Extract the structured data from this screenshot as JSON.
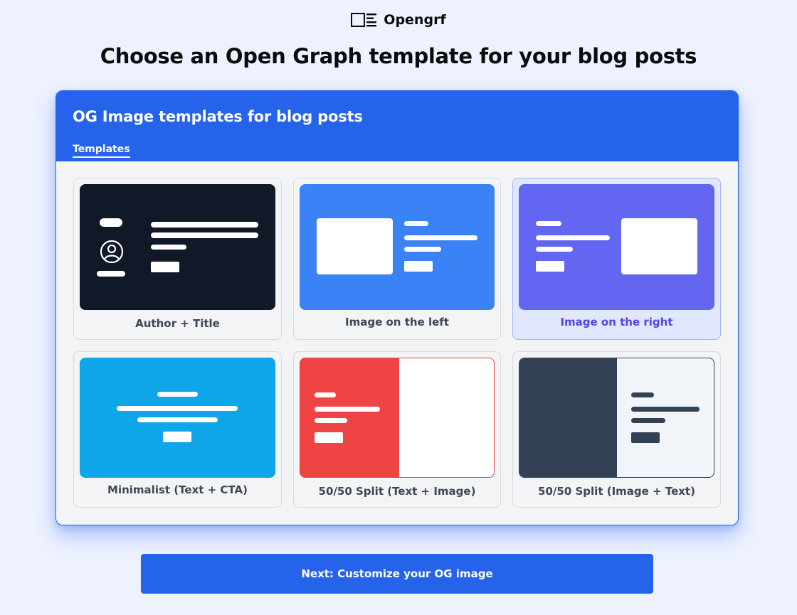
{
  "brand": {
    "name": "Opengrf",
    "icon": "newspaper-icon"
  },
  "page": {
    "title": "Choose an Open Graph template for your blog posts"
  },
  "panel": {
    "title": "OG Image templates for blog posts",
    "tabs": [
      {
        "label": "Templates",
        "active": true
      }
    ]
  },
  "templates": [
    {
      "label": "Author + Title",
      "thumb_bg": "#111827",
      "selected": false
    },
    {
      "label": "Image on the left",
      "thumb_bg": "#3b82f6",
      "selected": false
    },
    {
      "label": "Image on the right",
      "thumb_bg": "#6366f1",
      "selected": true
    },
    {
      "label": "Minimalist (Text + CTA)",
      "thumb_bg": "#0ea5e9",
      "selected": false
    },
    {
      "label": "50/50 Split (Text + Image)",
      "thumb_bg": "#ef4444",
      "selected": false
    },
    {
      "label": "50/50 Split (Image + Text)",
      "thumb_bg": "#334155",
      "selected": false
    }
  ],
  "footer": {
    "next_button_label": "Next: Customize your OG image"
  },
  "colors": {
    "accent": "#2563eb",
    "background": "#eef2ff",
    "selected_text": "#4f46e5"
  }
}
